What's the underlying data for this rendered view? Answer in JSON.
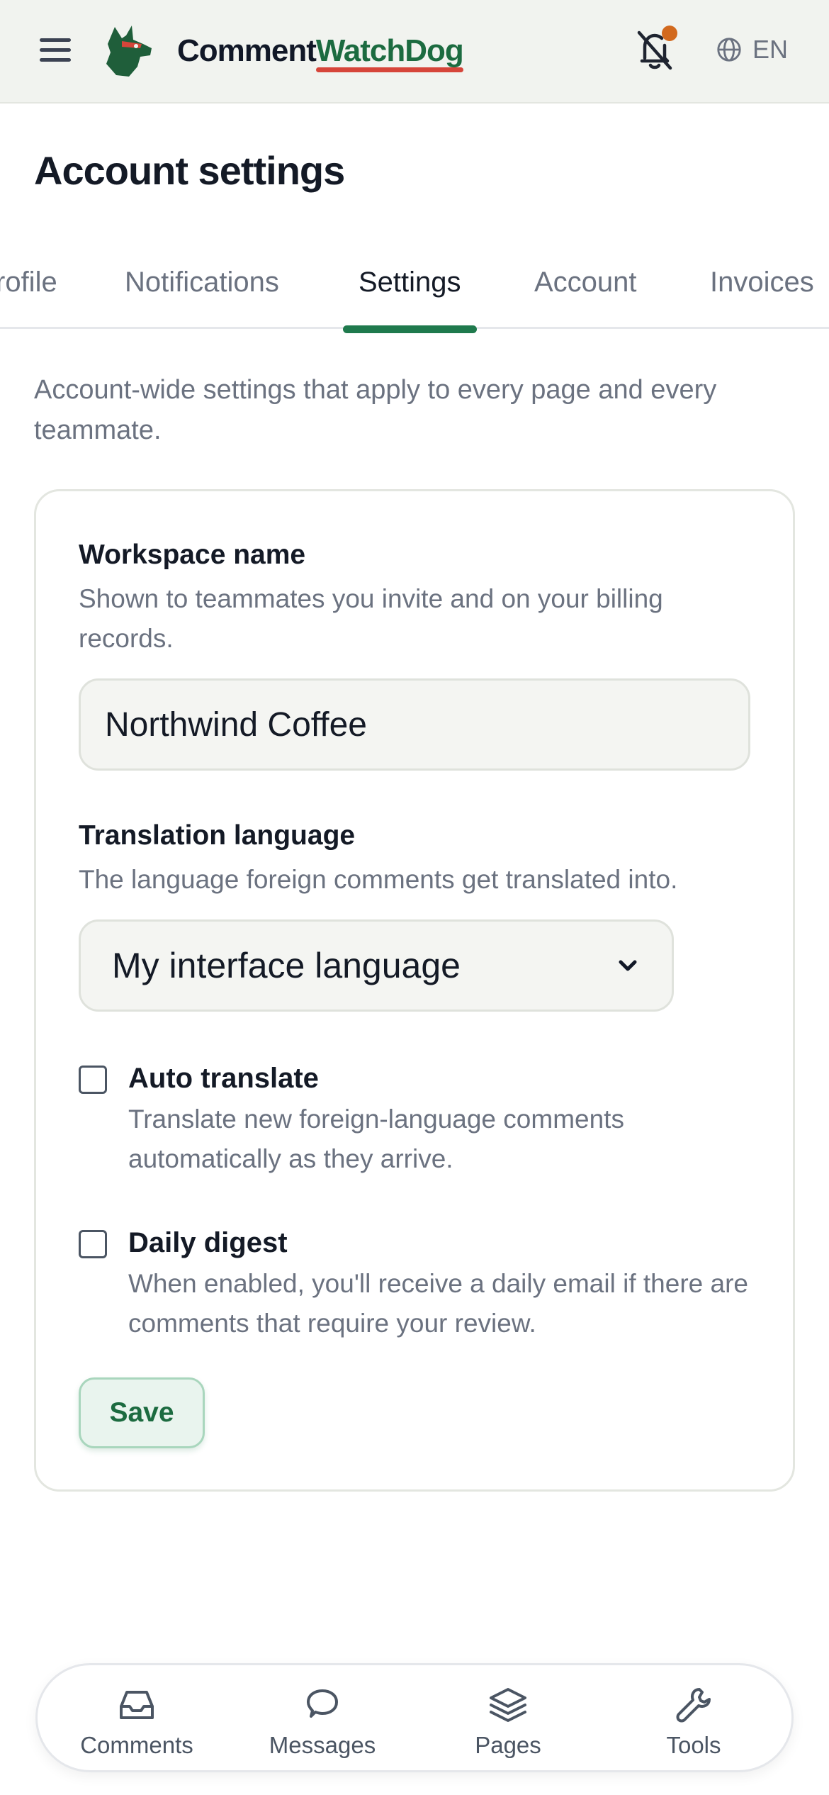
{
  "header": {
    "brand_part1": "Comment",
    "brand_part2": "WatchDog",
    "language": "EN",
    "colors": {
      "brand_green": "#1c6b40",
      "brand_underline": "#d6453a",
      "notification_dot": "#d2691e"
    }
  },
  "page_title": "Account settings",
  "tabs": [
    {
      "label": "Profile",
      "visible_label": "rofile",
      "active": false
    },
    {
      "label": "Notifications",
      "active": false
    },
    {
      "label": "Settings",
      "active": true
    },
    {
      "label": "Account",
      "active": false
    },
    {
      "label": "Invoices",
      "active": false
    }
  ],
  "intro": "Account-wide settings that apply to every page and every teammate.",
  "form": {
    "workspace": {
      "label": "Workspace name",
      "help": "Shown to teammates you invite and on your billing records.",
      "value": "Northwind Coffee"
    },
    "translation": {
      "label": "Translation language",
      "help": "The language foreign comments get translated into.",
      "selected": "My interface language"
    },
    "auto_translate": {
      "label": "Auto translate",
      "desc": "Translate new foreign-language comments automatically as they arrive.",
      "checked": false
    },
    "daily_digest": {
      "label": "Daily digest",
      "desc": "When enabled, you'll receive a daily email if there are comments that require your review.",
      "checked": false
    },
    "save_label": "Save"
  },
  "bottom_nav": [
    {
      "label": "Comments",
      "icon": "inbox-icon"
    },
    {
      "label": "Messages",
      "icon": "chat-bubble-icon"
    },
    {
      "label": "Pages",
      "icon": "layers-icon"
    },
    {
      "label": "Tools",
      "icon": "wrench-icon"
    }
  ]
}
